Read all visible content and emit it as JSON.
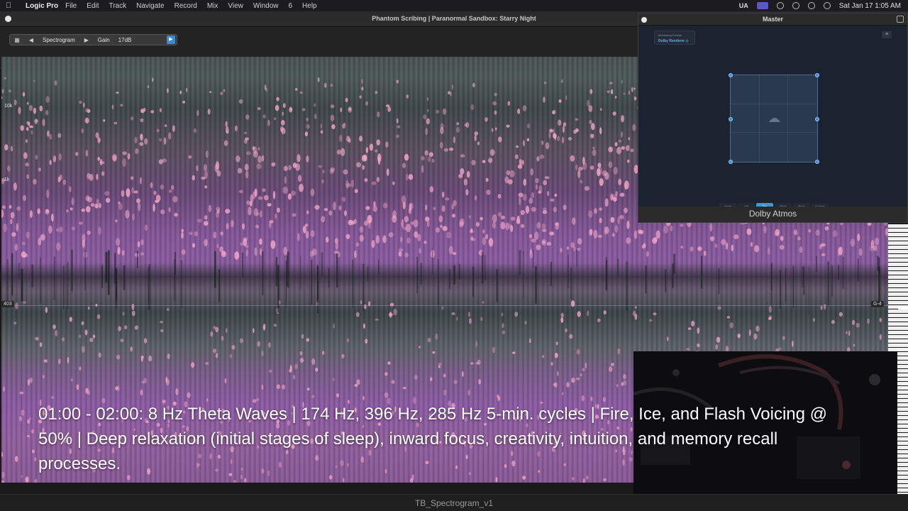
{
  "menubar": {
    "apple_icon": "apple-icon",
    "app_name": "Logic Pro",
    "items": [
      "File",
      "Edit",
      "Track",
      "Navigate",
      "Record",
      "Mix",
      "View",
      "Window",
      "6",
      "Help"
    ],
    "input_source": "UA",
    "clock": "Sat Jan 17  1:05 AM"
  },
  "window": {
    "title": "Phantom Scribing | Paranormal Sandbox: Starry Night"
  },
  "toolbar": {
    "view_label": "Spectrogram",
    "gain_label": "Gain",
    "gain_value": "17dB"
  },
  "spectrogram": {
    "freq_10k": "10k",
    "freq_1k": "1k",
    "marker_left": "403",
    "marker_right": "G-4",
    "colors": {
      "low": "#4a5556",
      "mid": "#8a5ca0",
      "hot": "#f2a6c8"
    }
  },
  "master": {
    "title": "Master",
    "monitoring_label": "Monitoring Format",
    "monitoring_value": "Dolby Renderer ◇",
    "view_buttons": [
      "Angle",
      "Left",
      "Top",
      "Right",
      "Back",
      "Custom"
    ],
    "active_view": "Top",
    "footer": "Dolby Atmos"
  },
  "caption": {
    "text": "01:00 - 02:00:   8 Hz Theta Waves | 174 Hz, 396 Hz, 285 Hz 5-min. cycles | Fire, Ice, and Flash Voicing @ 50% | Deep relaxation (initial stages of sleep), inward focus, creativity, intuition, and memory recall processes."
  },
  "bottombar": {
    "filename": "TB_Spectrogram_v1"
  }
}
